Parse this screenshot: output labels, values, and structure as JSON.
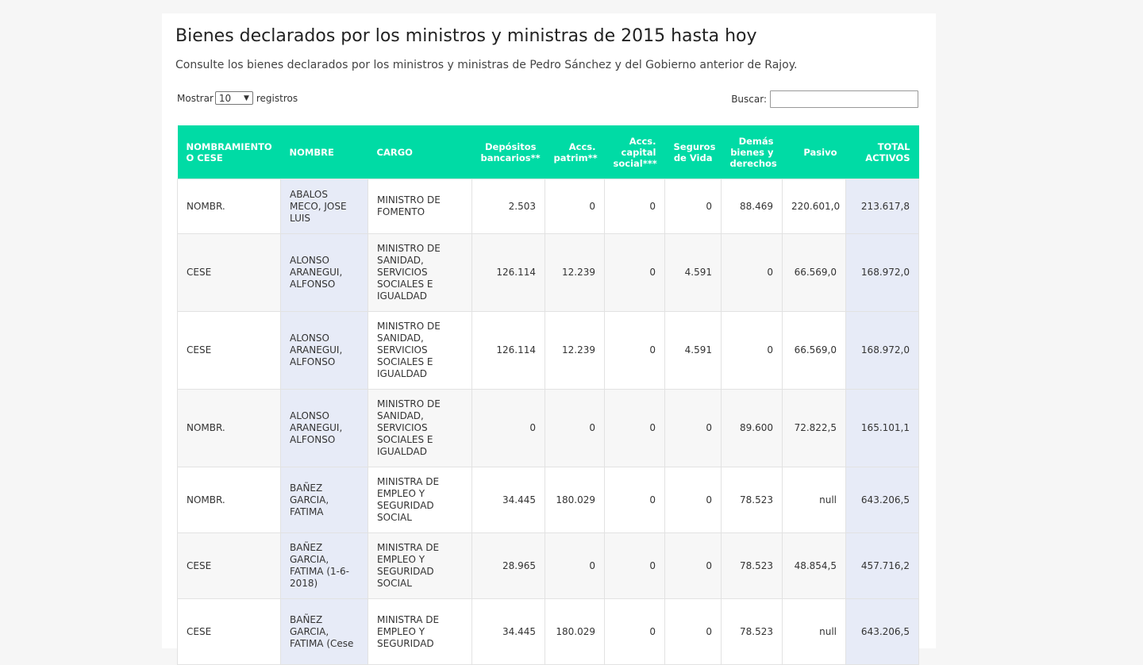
{
  "title": "Bienes declarados por los ministros y ministras de 2015 hasta hoy",
  "subtitle": "Consulte los bienes declarados por los ministros y ministras de Pedro Sánchez y del Gobierno anterior de Rajoy.",
  "length": {
    "prefix": "Mostrar",
    "value": "10",
    "suffix": "registros"
  },
  "search": {
    "label": "Buscar:",
    "value": ""
  },
  "headers": [
    "NOMBRAMIENTO O CESE",
    "NOMBRE",
    "CARGO",
    "Depósitos bancarios**",
    "Accs. patrim**",
    "Accs. capital social***",
    "Seguros de Vida",
    "Demás bienes y derechos",
    "Pasivo",
    "TOTAL ACTIVOS"
  ],
  "rows": [
    [
      "NOMBR.",
      "ABALOS MECO, JOSE LUIS",
      "MINISTRO DE FOMENTO",
      "2.503",
      "0",
      "0",
      "0",
      "88.469",
      "220.601,0",
      "213.617,8"
    ],
    [
      "CESE",
      "ALONSO ARANEGUI, ALFONSO",
      "MINISTRO DE SANIDAD, SERVICIOS SOCIALES E IGUALDAD",
      "126.114",
      "12.239",
      "0",
      "4.591",
      "0",
      "66.569,0",
      "168.972,0"
    ],
    [
      "CESE",
      "ALONSO ARANEGUI, ALFONSO",
      "MINISTRO DE SANIDAD, SERVICIOS SOCIALES E IGUALDAD",
      "126.114",
      "12.239",
      "0",
      "4.591",
      "0",
      "66.569,0",
      "168.972,0"
    ],
    [
      "NOMBR.",
      "ALONSO ARANEGUI, ALFONSO",
      "MINISTRO DE SANIDAD, SERVICIOS SOCIALES E IGUALDAD",
      "0",
      "0",
      "0",
      "0",
      "89.600",
      "72.822,5",
      "165.101,1"
    ],
    [
      "NOMBR.",
      "BAÑEZ GARCIA, FATIMA",
      "MINISTRA DE EMPLEO Y SEGURIDAD SOCIAL",
      "34.445",
      "180.029",
      "0",
      "0",
      "78.523",
      "null",
      "643.206,5"
    ],
    [
      "CESE",
      "BAÑEZ GARCIA, FATIMA (1-6-2018)",
      "MINISTRA DE EMPLEO Y SEGURIDAD SOCIAL",
      "28.965",
      "0",
      "0",
      "0",
      "78.523",
      "48.854,5",
      "457.716,2"
    ],
    [
      "CESE",
      "BAÑEZ GARCIA, FATIMA (Cese",
      "MINISTRA DE EMPLEO Y SEGURIDAD",
      "34.445",
      "180.029",
      "0",
      "0",
      "78.523",
      "null",
      "643.206,5"
    ]
  ]
}
